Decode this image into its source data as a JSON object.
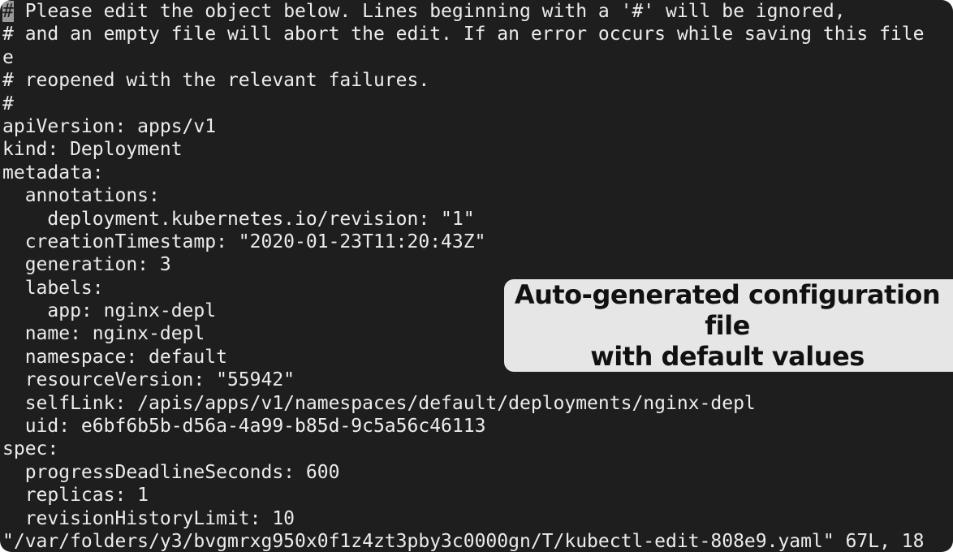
{
  "editor": {
    "cursor_char": "#",
    "lines": [
      " Please edit the object below. Lines beginning with a '#' will be ignored,",
      "# and an empty file will abort the edit. If an error occurs while saving this file",
      "e",
      "# reopened with the relevant failures.",
      "#",
      "apiVersion: apps/v1",
      "kind: Deployment",
      "metadata:",
      "  annotations:",
      "    deployment.kubernetes.io/revision: \"1\"",
      "  creationTimestamp: \"2020-01-23T11:20:43Z\"",
      "  generation: 3",
      "  labels:",
      "    app: nginx-depl",
      "  name: nginx-depl",
      "  namespace: default",
      "  resourceVersion: \"55942\"",
      "  selfLink: /apis/apps/v1/namespaces/default/deployments/nginx-depl",
      "  uid: e6bf6b5b-d56a-4a99-b85d-9c5a56c46113",
      "spec:",
      "  progressDeadlineSeconds: 600",
      "  replicas: 1",
      "  revisionHistoryLimit: 10"
    ],
    "status_line": "\"/var/folders/y3/bvgmrxg950x0f1z4zt3pby3c0000gn/T/kubectl-edit-808e9.yaml\" 67L, 18"
  },
  "callout": {
    "line1": "Auto-generated configuration file",
    "line2": "with default values"
  },
  "colors": {
    "background": "#1e1e1e",
    "text": "#ececec",
    "cursor": "#9a9a9a",
    "callout_background": "#e6e6e6",
    "callout_text": "#111111"
  }
}
